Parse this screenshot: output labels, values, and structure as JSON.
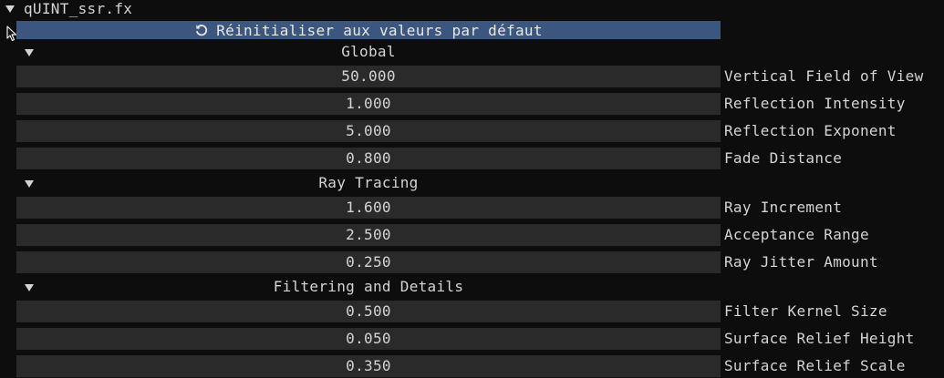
{
  "file": {
    "title": "qUINT_ssr.fx"
  },
  "reset": {
    "label": "Réinitialiser aux valeurs par défaut",
    "icon": "reset-icon"
  },
  "sections": [
    {
      "label": "Global",
      "rows": [
        {
          "value": "50.000",
          "name": "Vertical Field of View"
        },
        {
          "value": "1.000",
          "name": "Reflection Intensity"
        },
        {
          "value": "5.000",
          "name": "Reflection Exponent"
        },
        {
          "value": "0.800",
          "name": "Fade Distance"
        }
      ]
    },
    {
      "label": "Ray Tracing",
      "rows": [
        {
          "value": "1.600",
          "name": "Ray Increment"
        },
        {
          "value": "2.500",
          "name": "Acceptance Range"
        },
        {
          "value": "0.250",
          "name": "Ray Jitter Amount"
        }
      ]
    },
    {
      "label": "Filtering and Details",
      "rows": [
        {
          "value": "0.500",
          "name": "Filter Kernel Size"
        },
        {
          "value": "0.050",
          "name": "Surface Relief Height"
        },
        {
          "value": "0.350",
          "name": "Surface Relief Scale"
        }
      ]
    }
  ],
  "colors": {
    "background": "#0d0d0d",
    "field": "#2a2a2a",
    "button": "#3b567f",
    "text": "#d4d4d4"
  }
}
